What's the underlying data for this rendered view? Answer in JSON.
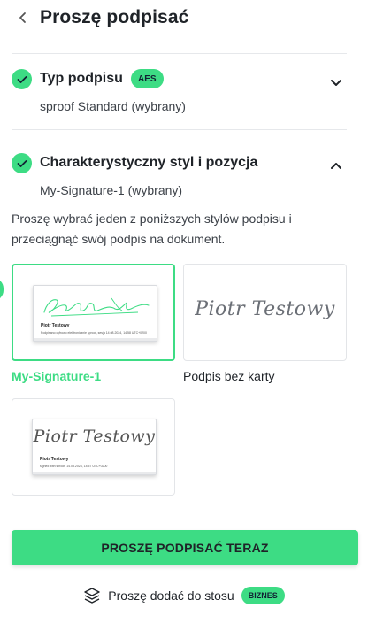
{
  "header": {
    "title": "Proszę podpisać"
  },
  "sections": [
    {
      "title": "Typ podpisu",
      "badge": "AES",
      "subtitle": "sproof Standard (wybrany)"
    },
    {
      "title": "Charakterystyczny styl i pozycja",
      "subtitle": "My-Signature-1 (wybrany)"
    }
  ],
  "instruction": "Proszę wybrać jeden z poniższych stylów podpisu i przeciągnąć swój podpis na dokument.",
  "cards": [
    {
      "label": "My-Signature-1",
      "signer": "Piotr Testowy",
      "note": "Podpisano cyfrowo elektronicznie sproof, sesja 14.08.2024, 14:58 UTC+0200",
      "signature_color": "#3ddc84"
    },
    {
      "label": "Podpis bez karty",
      "signature_text": "Piotr Testowy"
    },
    {
      "signature_text": "Piotr Testowy",
      "signer": "Piotr Testowy",
      "note": "signed with sproof, 14.08.2024, 14:57 UTC+0200"
    }
  ],
  "cta": {
    "label": "PROSZĘ PODPISAĆ TERAZ"
  },
  "stack": {
    "label": "Proszę dodać do stosu",
    "badge": "BIZNES"
  },
  "colors": {
    "accent": "#3ddc84",
    "text": "#1f2328",
    "muted": "#3c4148",
    "divider": "#e6e8eb"
  }
}
